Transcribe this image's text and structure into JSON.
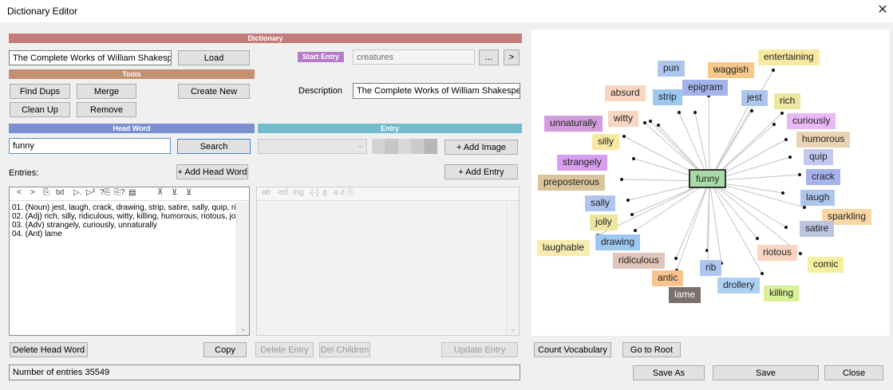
{
  "window": {
    "title": "Dictionary Editor",
    "close_glyph": "✕"
  },
  "bands": {
    "dictionary": "Dictionary",
    "tools": "Tools",
    "head_word": "Head Word",
    "entry": "Entry"
  },
  "colors": {
    "dictionary": "#c47c7a",
    "tools": "#c39070",
    "head_word": "#7a8fcf",
    "entry": "#74bccb",
    "start_entry": "#b57cc7"
  },
  "dictionary": {
    "name": "The Complete Works of William Shakespeare,",
    "load": "Load"
  },
  "start_entry": {
    "label": "Start Entry",
    "value": "creatures",
    "browse": "...",
    "next": ">"
  },
  "tools": {
    "find_dups": "Find Dups",
    "merge": "Merge",
    "create_new": "Create New",
    "clean_up": "Clean Up",
    "remove": "Remove"
  },
  "description": {
    "label": "Description",
    "value": "The Complete Works of William Shakespeare, b"
  },
  "head_word": {
    "value": "funny",
    "search": "Search",
    "add_head_word": "+ Add Head Word"
  },
  "entry": {
    "add_image": "+ Add Image",
    "add_entry": "+ Add Entry"
  },
  "entries": {
    "label": "Entries:",
    "toolbar": [
      "<",
      ">",
      "⎘",
      "txt",
      "▷.",
      "▷²",
      "?⎘",
      "⎘?",
      "▤",
      "⊼",
      "⊻",
      "⊻"
    ],
    "lines": [
      "01. (Noun) jest, laugh, crack, drawing, strip, satire, sally, quip, ri",
      "02. (Adj) rich, silly, ridiculous, witty, killing, humorous, riotous, jol",
      "03. (Adv) strangely, curiously, unnaturally",
      "04. (Ant) lame"
    ]
  },
  "entry_toolbar": [
    "ab",
    "·ed",
    "·ing",
    "·{·}",
    "a̲",
    "a·z",
    "⎘"
  ],
  "buttons": {
    "delete_head_word": "Delete Head Word",
    "copy": "Copy",
    "delete_entry": "Delete Entry",
    "del_children": "Del Children",
    "update_entry": "Update Entry",
    "count_vocabulary": "Count Vocabulary",
    "go_to_root": "Go to Root",
    "save_as": "Save As",
    "save": "Save",
    "close": "Close"
  },
  "status": "Number of entries 35549",
  "graph": {
    "center": "funny",
    "nodes": [
      {
        "label": "pun",
        "color": "#aec6ee"
      },
      {
        "label": "waggish",
        "color": "#f6c98b"
      },
      {
        "label": "entertaining",
        "color": "#f8e9a2"
      },
      {
        "label": "absurd",
        "color": "#f9d6c2"
      },
      {
        "label": "strip",
        "color": "#9cc8f0"
      },
      {
        "label": "epigram",
        "color": "#a6b3ea"
      },
      {
        "label": "jest",
        "color": "#aec6ee"
      },
      {
        "label": "rich",
        "color": "#ece6a1"
      },
      {
        "label": "witty",
        "color": "#f9d6c2"
      },
      {
        "label": "unnaturally",
        "color": "#d39ddd"
      },
      {
        "label": "curiously",
        "color": "#e9b8f6"
      },
      {
        "label": "silly",
        "color": "#f8e9a2"
      },
      {
        "label": "humorous",
        "color": "#e8d4b2"
      },
      {
        "label": "quip",
        "color": "#c2c8ee"
      },
      {
        "label": "strangely",
        "color": "#d79ef0"
      },
      {
        "label": "crack",
        "color": "#a6b3ea"
      },
      {
        "label": "preposterous",
        "color": "#d9c59b"
      },
      {
        "label": "laugh",
        "color": "#aec6ee"
      },
      {
        "label": "sally",
        "color": "#aec6ee"
      },
      {
        "label": "sparkling",
        "color": "#f9d6a6"
      },
      {
        "label": "jolly",
        "color": "#ece6a1"
      },
      {
        "label": "satire",
        "color": "#bbc4df"
      },
      {
        "label": "drawing",
        "color": "#9cc8f0"
      },
      {
        "label": "laughable",
        "color": "#f8ecb0"
      },
      {
        "label": "riotous",
        "color": "#f9d6c2"
      },
      {
        "label": "ridiculous",
        "color": "#e1c4bb"
      },
      {
        "label": "comic",
        "color": "#f3ef9e"
      },
      {
        "label": "rib",
        "color": "#aec6ee"
      },
      {
        "label": "antic",
        "color": "#f7c38e"
      },
      {
        "label": "drollery",
        "color": "#aed0f5"
      },
      {
        "label": "killing",
        "color": "#d8f196"
      },
      {
        "label": "lame",
        "color": "#7a6e6e"
      }
    ]
  }
}
